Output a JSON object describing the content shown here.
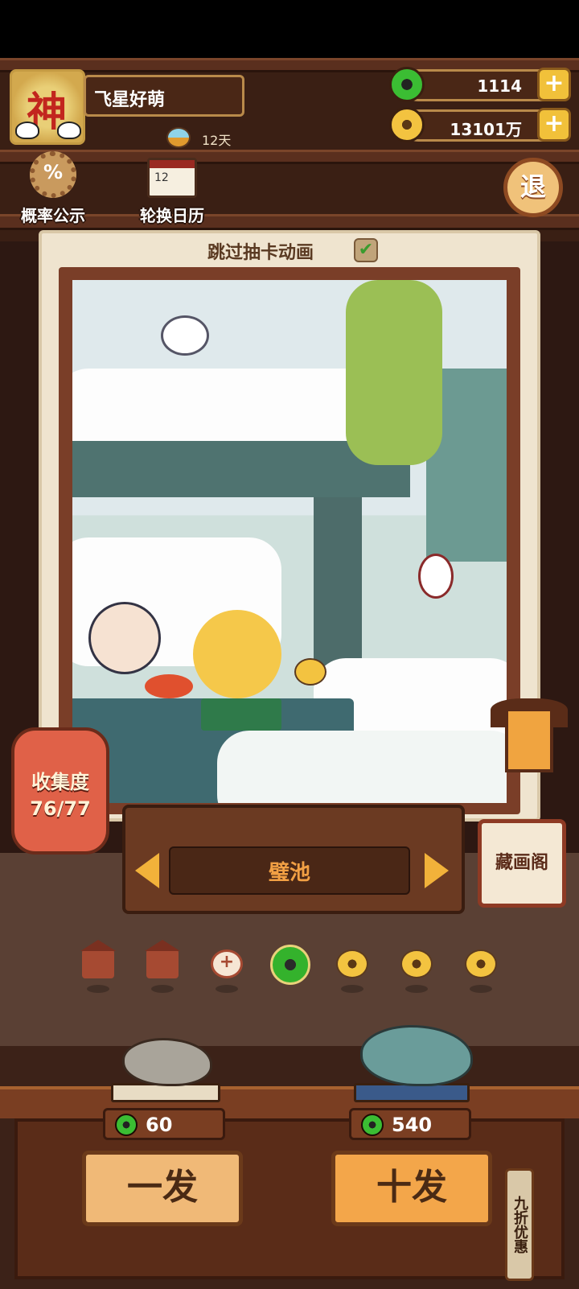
{
  "profile": {
    "avatar_glyph": "神",
    "name": "飞星好萌",
    "days": "12天"
  },
  "currency": {
    "jade_amount": "1114",
    "gold_amount": "13101万",
    "add_label": "+"
  },
  "menu": {
    "probability_label": "概率公示",
    "probability_glyph": "%",
    "calendar_label": "轮换日历",
    "calendar_glyph": "12",
    "exit_label": "退"
  },
  "card": {
    "skip_label": "跳过抽卡动画",
    "skip_checked": true,
    "check_glyph": "✔",
    "picture_name": "璧池"
  },
  "collection": {
    "label": "收集度",
    "progress": "76/77"
  },
  "gallery": {
    "label": "藏画阁"
  },
  "pager": {
    "items": [
      "house",
      "house",
      "plus",
      "jade",
      "coin",
      "coin",
      "coin"
    ],
    "plus_glyph": "+",
    "selected_index": 3
  },
  "draw": {
    "single_price": "60",
    "ten_price": "540",
    "single_label": "一发",
    "ten_label": "十发",
    "discount_label": "九折优惠"
  },
  "colors": {
    "accent": "#f2b23a",
    "jade": "#3bbd33",
    "wood": "#5a2c18"
  }
}
